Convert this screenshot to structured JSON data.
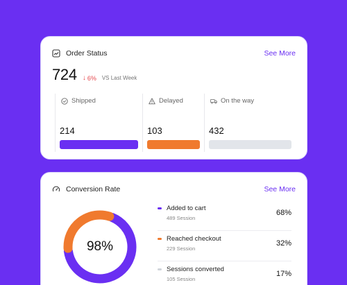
{
  "colors": {
    "background": "#6a2ff2",
    "accent": "#6a2ff2",
    "shipped": "#6a2ff2",
    "delayed": "#f07a2e",
    "on_the_way": "#e2e5ea",
    "negative": "#e5484d"
  },
  "order_status": {
    "title": "Order Status",
    "title_icon": "chart-report-icon",
    "see_more": "See More",
    "total": "724",
    "delta_arrow": "↓",
    "delta": "6%",
    "compare_label": "VS Last Week",
    "columns": [
      {
        "label": "Shipped",
        "icon": "check-circle-icon",
        "value": "214"
      },
      {
        "label": "Delayed",
        "icon": "warning-triangle-icon",
        "value": "103"
      },
      {
        "label": "On the way",
        "icon": "truck-icon",
        "value": "432"
      }
    ]
  },
  "conversion": {
    "title": "Conversion Rate",
    "title_icon": "gauge-icon",
    "see_more": "See More",
    "center_label": "98%",
    "donut_segments": [
      {
        "name": "Added to cart",
        "fraction": 0.68,
        "color": "#6a2ff2"
      },
      {
        "name": "Reached checkout",
        "fraction": 0.32,
        "color": "#f07a2e"
      }
    ],
    "items": [
      {
        "name": "Added to cart",
        "sessions": "489 Session",
        "percent": "68%",
        "color": "#6a2ff2"
      },
      {
        "name": "Reached checkout",
        "sessions": "229 Session",
        "percent": "32%",
        "color": "#f07a2e"
      },
      {
        "name": "Sessions converted",
        "sessions": "105 Session",
        "percent": "17%",
        "color": "#d0d4da"
      }
    ]
  }
}
